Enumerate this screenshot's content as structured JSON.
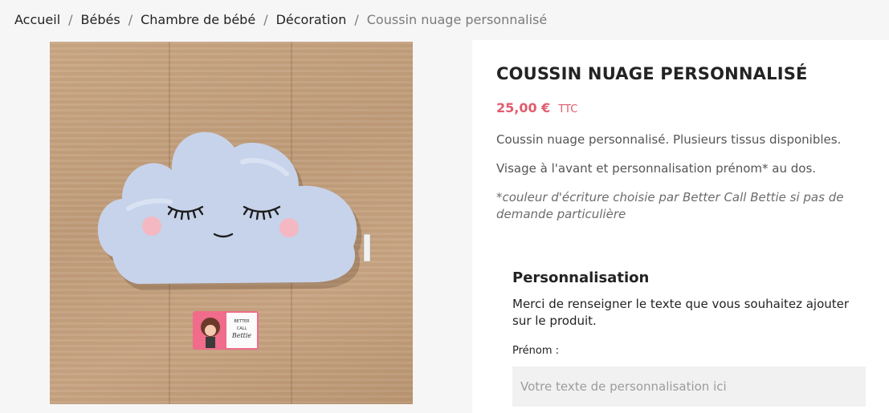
{
  "breadcrumb": {
    "items": [
      "Accueil",
      "Bébés",
      "Chambre de bébé",
      "Décoration",
      "Coussin nuage personnalisé"
    ],
    "separator": "/"
  },
  "product": {
    "title": "COUSSIN NUAGE PERSONNALISÉ",
    "price": "25,00 €",
    "tax_label": "TTC",
    "description": [
      "Coussin nuage personnalisé. Plusieurs tissus disponibles.",
      "Visage à l'avant et personnalisation prénom* au dos.",
      "*couleur d'écriture choisie par Better Call Bettie si pas de demande particulière"
    ],
    "image_card_text": [
      "BETTER",
      "CALL",
      "Bettie"
    ]
  },
  "personalisation": {
    "title": "Personnalisation",
    "instructions": "Merci de renseigner le texte que vous souhaitez ajouter sur le produit.",
    "field_label": "Prénom :",
    "field_value": "",
    "field_placeholder": "Votre texte de personnalisation ici"
  },
  "colors": {
    "accent_price": "#e05c6d",
    "panel_background": "#ffffff",
    "page_background": "#f6f6f6",
    "cloud_fabric": "#c7d3ea",
    "cheeks": "#f4b8c3"
  }
}
